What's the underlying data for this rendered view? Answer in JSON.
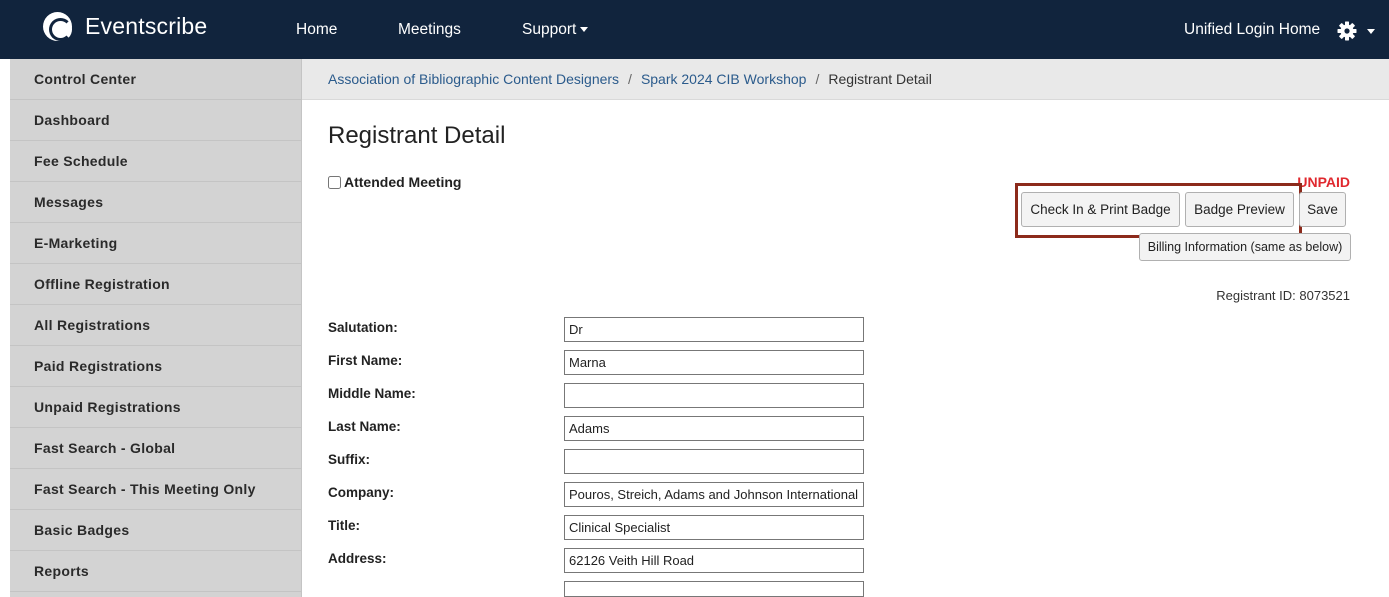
{
  "brand": {
    "name": "Eventscribe"
  },
  "nav": {
    "home": "Home",
    "meetings": "Meetings",
    "support": "Support",
    "unified_login": "Unified Login Home"
  },
  "sidebar": {
    "items": [
      {
        "label": "Control Center"
      },
      {
        "label": "Dashboard"
      },
      {
        "label": "Fee Schedule"
      },
      {
        "label": "Messages"
      },
      {
        "label": "E-Marketing"
      },
      {
        "label": "Offline Registration"
      },
      {
        "label": "All Registrations"
      },
      {
        "label": "Paid Registrations"
      },
      {
        "label": "Unpaid Registrations"
      },
      {
        "label": "Fast Search - Global"
      },
      {
        "label": "Fast Search - This Meeting Only"
      },
      {
        "label": "Basic Badges"
      },
      {
        "label": "Reports"
      }
    ]
  },
  "breadcrumb": {
    "org": "Association of Bibliographic Content Designers",
    "meeting": "Spark 2024 CIB Workshop",
    "current": "Registrant Detail"
  },
  "page": {
    "title": "Registrant Detail",
    "attended_label": "Attended Meeting",
    "status": "UNPAID",
    "status_color": "#e0282e",
    "highlight_color": "#8c2a1b"
  },
  "actions": {
    "check_in": "Check In & Print Badge",
    "badge_preview": "Badge Preview",
    "save": "Save",
    "billing": "Billing Information (same as below)"
  },
  "registrant": {
    "id_text": "Registrant ID: 8073521"
  },
  "form": {
    "fields": [
      {
        "label": "Salutation:",
        "value": "Dr"
      },
      {
        "label": "First Name:",
        "value": "Marna"
      },
      {
        "label": "Middle Name:",
        "value": ""
      },
      {
        "label": "Last Name:",
        "value": "Adams"
      },
      {
        "label": "Suffix:",
        "value": ""
      },
      {
        "label": "Company:",
        "value": "Pouros, Streich, Adams and Johnson International"
      },
      {
        "label": "Title:",
        "value": "Clinical Specialist"
      },
      {
        "label": "Address:",
        "value": "62126 Veith Hill Road"
      },
      {
        "label": "",
        "value": ""
      }
    ]
  }
}
